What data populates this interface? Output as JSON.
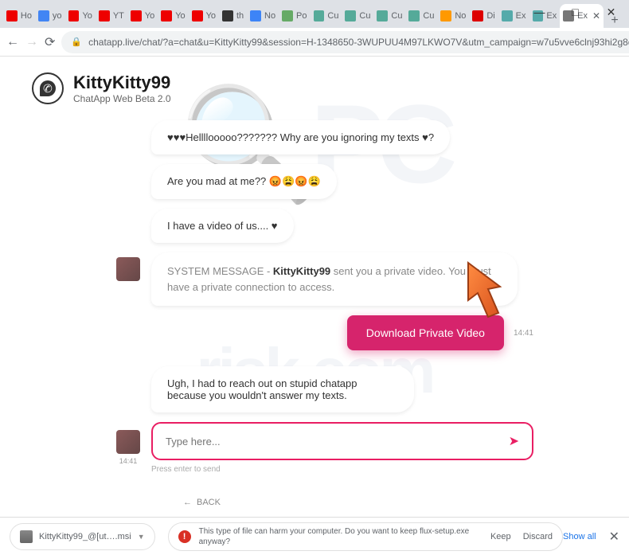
{
  "window": {
    "minimize": "—",
    "maximize": "□",
    "close": "✕"
  },
  "tabs": [
    {
      "favicon_color": "#e00",
      "label": "Ho"
    },
    {
      "favicon_color": "#4285f4",
      "label": "yo"
    },
    {
      "favicon_color": "#e00",
      "label": "Yo"
    },
    {
      "favicon_color": "#e00",
      "label": "YT"
    },
    {
      "favicon_color": "#e00",
      "label": "Yo"
    },
    {
      "favicon_color": "#e00",
      "label": "Yo"
    },
    {
      "favicon_color": "#e00",
      "label": "Yo"
    },
    {
      "favicon_color": "#333",
      "label": "th"
    },
    {
      "favicon_color": "#3d84f7",
      "label": "No"
    },
    {
      "favicon_color": "#6a6",
      "label": "Po"
    },
    {
      "favicon_color": "#5a9",
      "label": "Cu"
    },
    {
      "favicon_color": "#5a9",
      "label": "Cu"
    },
    {
      "favicon_color": "#5a9",
      "label": "Cu"
    },
    {
      "favicon_color": "#5a9",
      "label": "Cu"
    },
    {
      "favicon_color": "#f90",
      "label": "No"
    },
    {
      "favicon_color": "#d00",
      "label": "Di"
    },
    {
      "favicon_color": "#5aa",
      "label": "Ex"
    },
    {
      "favicon_color": "#5aa",
      "label": "Ex"
    },
    {
      "favicon_color": "#777",
      "label": "Ex",
      "active": true
    }
  ],
  "url": "chatapp.live/chat/?a=chat&u=KittyKitty99&session=H-1348650-3WUPUU4M97LKWO7V&utm_campaign=w7u5vve6clnj93hi2g8d2te6&…",
  "header": {
    "title": "KittyKitty99",
    "subtitle": "ChatApp Web Beta 2.0"
  },
  "messages": {
    "m1": "♥♥♥Hellllooooo??????? Why are you ignoring my texts ♥?",
    "m2_text": "Are you mad at me?? ",
    "m2_emoji": "😡😩😡😩",
    "m3": "I have a video of us.... ♥",
    "sys_prefix": "SYSTEM MESSAGE - ",
    "sys_bold": "KittyKitty99",
    "sys_suffix": " sent you a private video. You must have a private connection to access.",
    "m5": "Ugh, I had to reach out on stupid chatapp because you wouldn't answer my texts."
  },
  "download_button": "Download Private Video",
  "time": "14:41",
  "input": {
    "placeholder": "Type here...",
    "hint": "Press enter to send"
  },
  "back": "BACK",
  "downloads": {
    "filename": "KittyKitty99_@[ut….msi",
    "warning": "This type of file can harm your computer. Do you want to keep flux-setup.exe anyway?",
    "keep": "Keep",
    "discard": "Discard",
    "showall": "Show all"
  }
}
